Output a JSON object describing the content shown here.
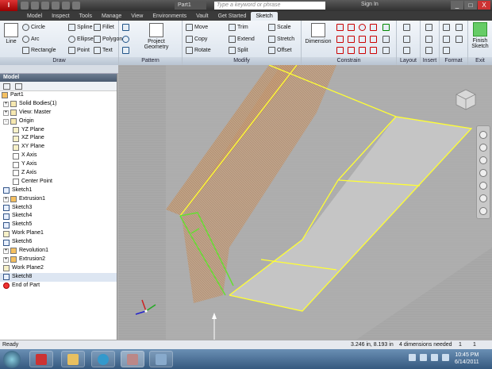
{
  "titlebar": {
    "app_button": "I",
    "document": "Part1",
    "search_placeholder": "Type a keyword or phrase",
    "signin": "Sign In",
    "minimize": "_",
    "maximize": "□",
    "close": "X"
  },
  "tabs": [
    "Model",
    "Inspect",
    "Tools",
    "Manage",
    "View",
    "Environments",
    "Vault",
    "Get Started",
    "Sketch"
  ],
  "active_tab": "Sketch",
  "ribbon": {
    "draw": {
      "label": "Draw",
      "line": "Line",
      "circle": "Circle",
      "arc": "Arc",
      "rectangle": "Rectangle",
      "spline": "Spline",
      "ellipse": "Ellipse",
      "point": "Point",
      "fillet": "Fillet",
      "polygon": "Polygon",
      "text": "Text"
    },
    "pattern": {
      "label": "Pattern",
      "project_geometry": "Project Geometry"
    },
    "modify": {
      "label": "Modify",
      "move": "Move",
      "copy": "Copy",
      "rotate": "Rotate",
      "trim": "Trim",
      "extend": "Extend",
      "split": "Split",
      "scale": "Scale",
      "stretch": "Stretch",
      "offset": "Offset"
    },
    "constrain": {
      "label": "Constrain",
      "dimension": "Dimension"
    },
    "layout": {
      "label": "Layout"
    },
    "insert": {
      "label": "Insert"
    },
    "format": {
      "label": "Format"
    },
    "exit": {
      "label": "Exit",
      "finish_sketch": "Finish Sketch"
    }
  },
  "browser": {
    "title": "Model",
    "nodes": [
      "Part1",
      "Solid Bodies(1)",
      "View: Master",
      "Origin",
      "YZ Plane",
      "XZ Plane",
      "XY Plane",
      "X Axis",
      "Y Axis",
      "Z Axis",
      "Center Point",
      "Sketch1",
      "Extrusion1",
      "Sketch3",
      "Sketch4",
      "Sketch5",
      "Work Plane1",
      "Sketch6",
      "Revolution1",
      "Extrusion2",
      "Work Plane2",
      "Sketch8",
      "End of Part"
    ]
  },
  "status": {
    "left": "Ready",
    "coordinates": "3.246 in, 8.193 in",
    "dimensions": "4 dimensions needed",
    "count": "1",
    "extra": "1"
  },
  "taskbar": {
    "time": "10:45 PM",
    "date": "6/14/2011"
  },
  "colors": {
    "sketch_yellow": "#ffff33",
    "sketch_green": "#66dd33",
    "surface_orange": "#c89a6a"
  }
}
